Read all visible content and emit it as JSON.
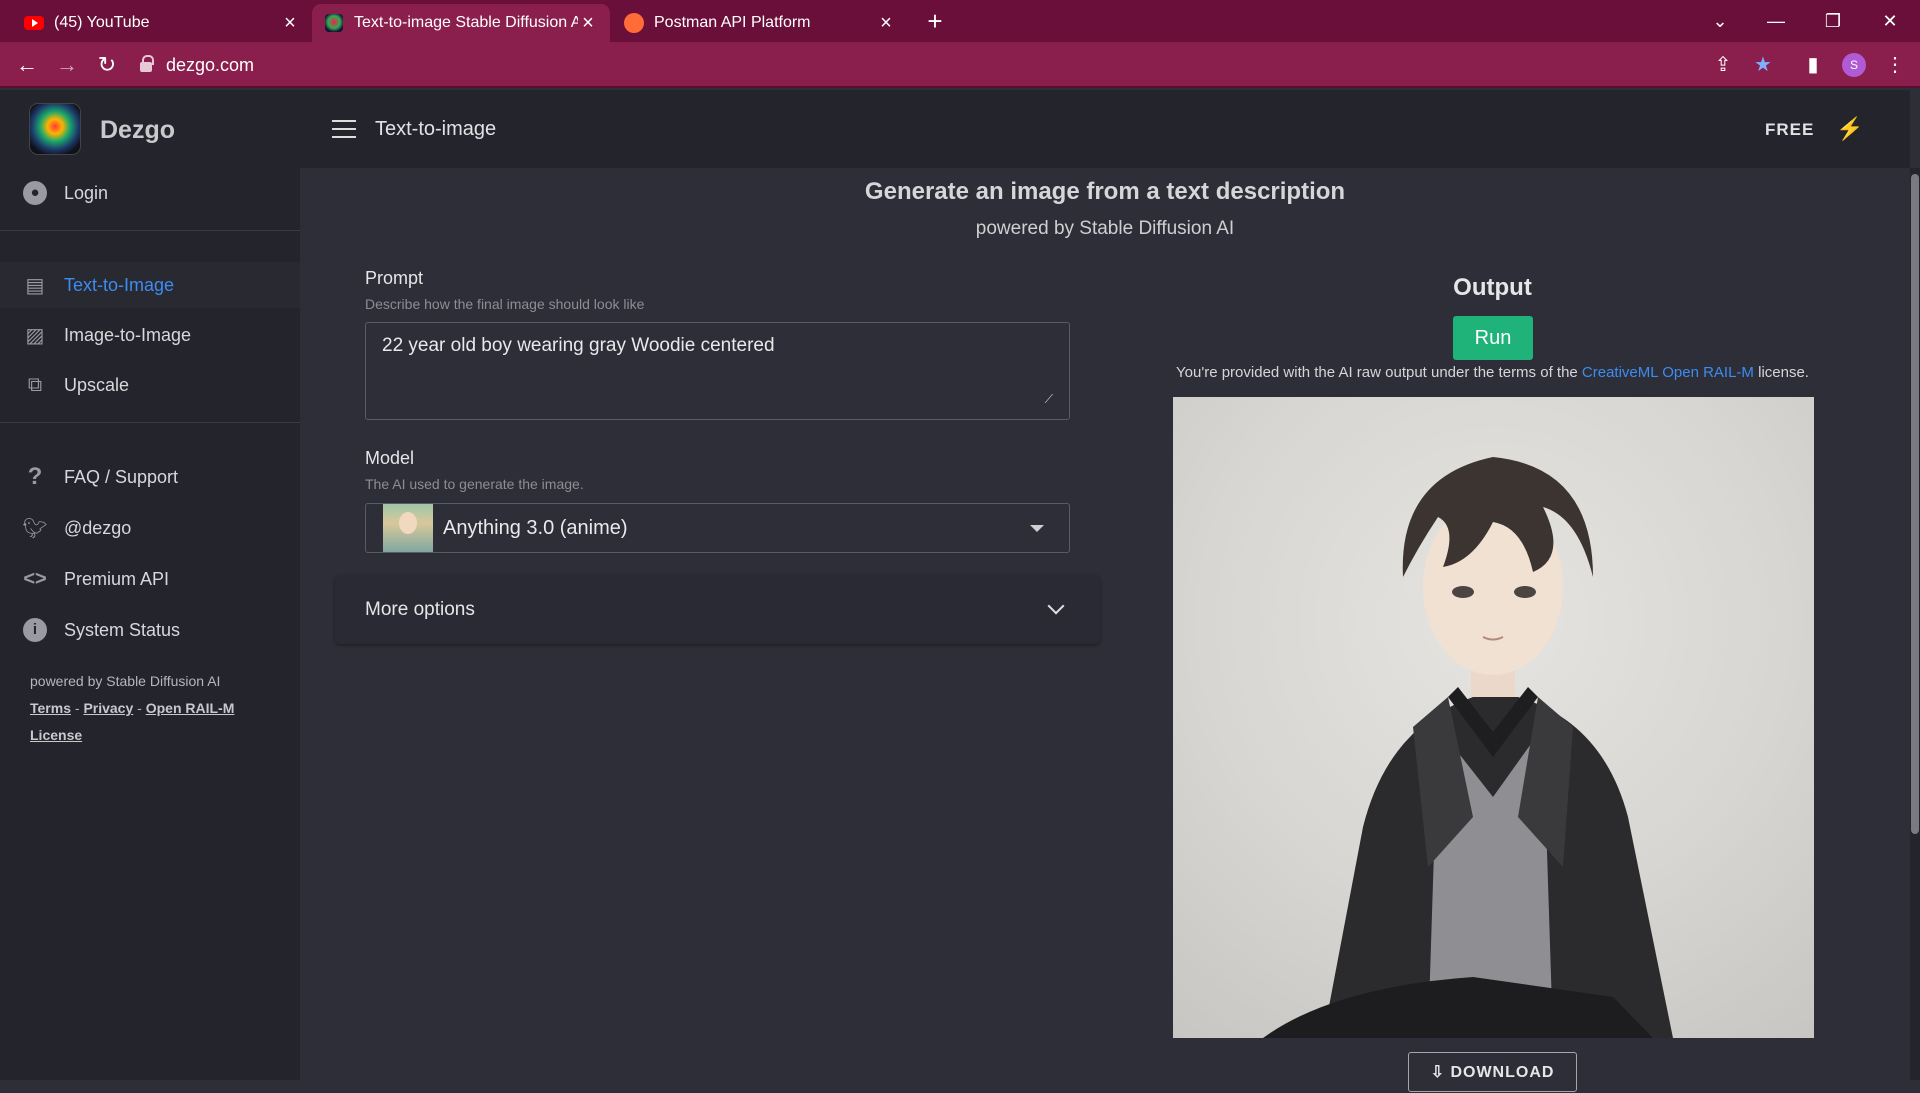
{
  "browser": {
    "tabs": [
      {
        "title": "(45) YouTube",
        "icon": "youtube-icon"
      },
      {
        "title": "Text-to-image Stable Diffusion AI",
        "icon": "dezgo-icon"
      },
      {
        "title": "Postman API Platform",
        "icon": "postman-icon"
      }
    ],
    "url": "dezgo.com",
    "profile_initial": "S"
  },
  "app": {
    "brand": "Dezgo",
    "page_title": "Text-to-image",
    "plan_badge": "FREE"
  },
  "sidebar": {
    "login": "Login",
    "nav": [
      {
        "label": "Text-to-Image",
        "icon": "chat-icon",
        "active": true
      },
      {
        "label": "Image-to-Image",
        "icon": "image-icon",
        "active": false
      },
      {
        "label": "Upscale",
        "icon": "upscale-icon",
        "active": false
      }
    ],
    "links": [
      {
        "label": "FAQ / Support",
        "icon": "question-icon"
      },
      {
        "label": "@dezgo",
        "icon": "twitter-icon"
      },
      {
        "label": "Premium API",
        "icon": "code-icon"
      },
      {
        "label": "System Status",
        "icon": "info-icon"
      }
    ],
    "footer": {
      "powered": "powered by Stable Diffusion AI",
      "terms": "Terms",
      "privacy": "Privacy",
      "license": "Open RAIL-M License"
    }
  },
  "main": {
    "heading": "Generate an image from a text description",
    "subheading": "powered by Stable Diffusion AI",
    "prompt": {
      "label": "Prompt",
      "help": "Describe how the final image should look like",
      "value": "22 year old boy wearing gray Woodie centered"
    },
    "model": {
      "label": "Model",
      "help": "The AI used to generate the image.",
      "selected": "Anything 3.0 (anime)"
    },
    "more_options": "More options",
    "output": {
      "title": "Output",
      "run": "Run",
      "terms_prefix": "You're provided with the AI raw output under the terms of the",
      "terms_link": "CreativeML Open RAIL-M",
      "terms_suffix": "license.",
      "download": "DOWNLOAD"
    }
  },
  "colors": {
    "tabbar": "#6a0f3a",
    "addressbar": "#8a1e4d",
    "sidebar_bg": "#23242c",
    "main_bg": "#2d2e37",
    "accent_link": "#3d8cf0",
    "run_button": "#1fb37a"
  }
}
